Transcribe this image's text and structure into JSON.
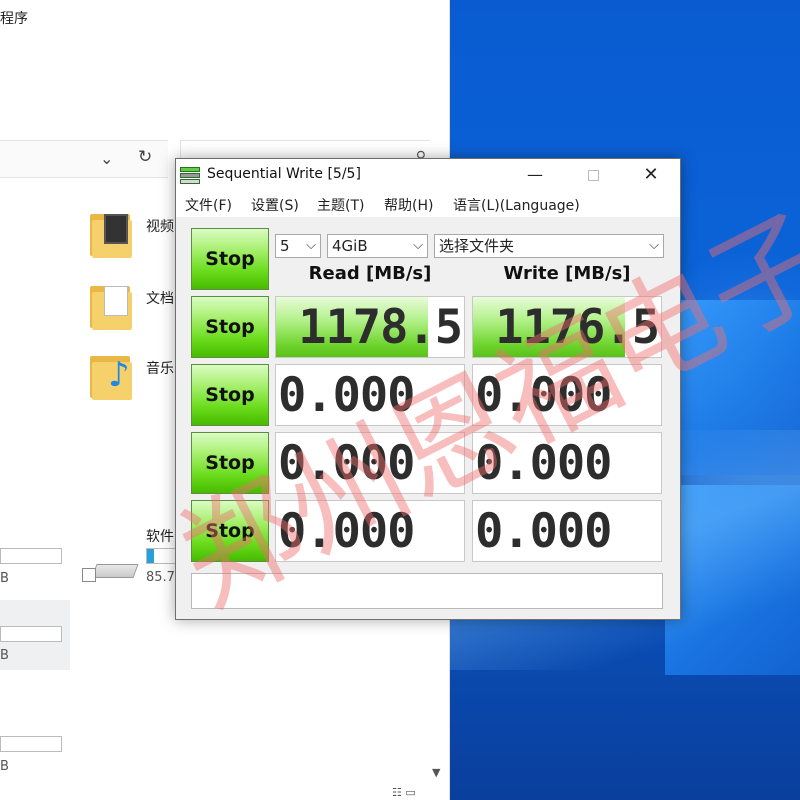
{
  "explorer": {
    "title_partial": "程序",
    "folders": [
      {
        "name": "视频"
      },
      {
        "name": "文档"
      },
      {
        "name": "音乐"
      }
    ],
    "drive_name": "软件",
    "drive_free_partial": "85.7",
    "drive_fill_fraction": 0.25,
    "size_suffix_1": "B",
    "size_suffix_2": "B",
    "size_suffix_3": "B"
  },
  "app": {
    "title": "Sequential Write [5/5]",
    "menu": [
      "文件(F)",
      "设置(S)",
      "主题(T)",
      "帮助(H)",
      "语言(L)(Language)"
    ],
    "controls": {
      "count": "5",
      "size": "4GiB",
      "target": "选择文件夹"
    },
    "headers": {
      "read": "Read [MB/s]",
      "write": "Write [MB/s]"
    },
    "stop_label": "Stop",
    "rows": [
      {
        "read": "1178.5",
        "write": "1176.5",
        "read_fill": 0.81,
        "write_fill": 0.81
      },
      {
        "read": "0.000",
        "write": "0.000",
        "read_fill": 0,
        "write_fill": 0
      },
      {
        "read": "0.000",
        "write": "0.000",
        "read_fill": 0,
        "write_fill": 0
      },
      {
        "read": "0.000",
        "write": "0.000",
        "read_fill": 0,
        "write_fill": 0
      }
    ]
  },
  "watermark": "郑州恩福电子",
  "icons": {
    "minimize": "minimize-icon",
    "maximize": "maximize-icon",
    "close": "close-icon",
    "refresh": "refresh-icon",
    "search": "search-icon",
    "dropdown": "chevron-down-icon"
  }
}
